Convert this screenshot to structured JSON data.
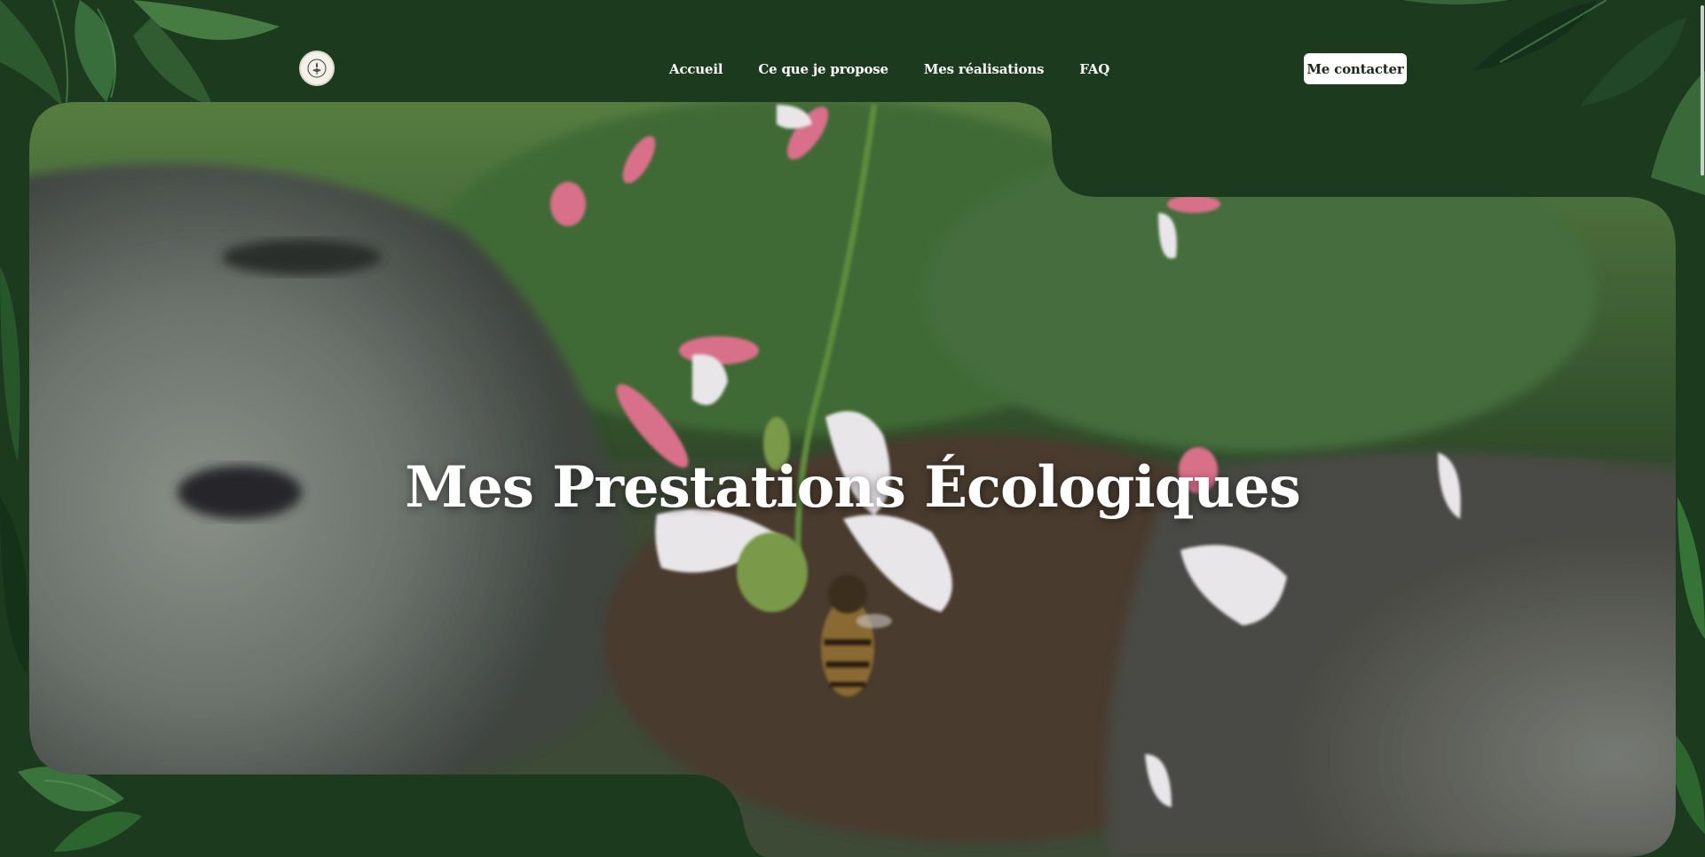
{
  "header": {
    "logo_label": "",
    "nav": [
      "Accueil",
      "Ce que je propose",
      "Mes réalisations",
      "FAQ"
    ],
    "cta_label": "Me contacter"
  },
  "hero": {
    "title": "Mes Prestations Écologiques"
  },
  "colors": {
    "background": "#1c3a1e",
    "leaf_dark": "#153018",
    "leaf_mid": "#2a5a2c",
    "leaf_light": "#3f7a40",
    "button_bg": "#ffffff",
    "text": "#ffffff"
  },
  "icons": {
    "logo": "emblem-icon"
  }
}
